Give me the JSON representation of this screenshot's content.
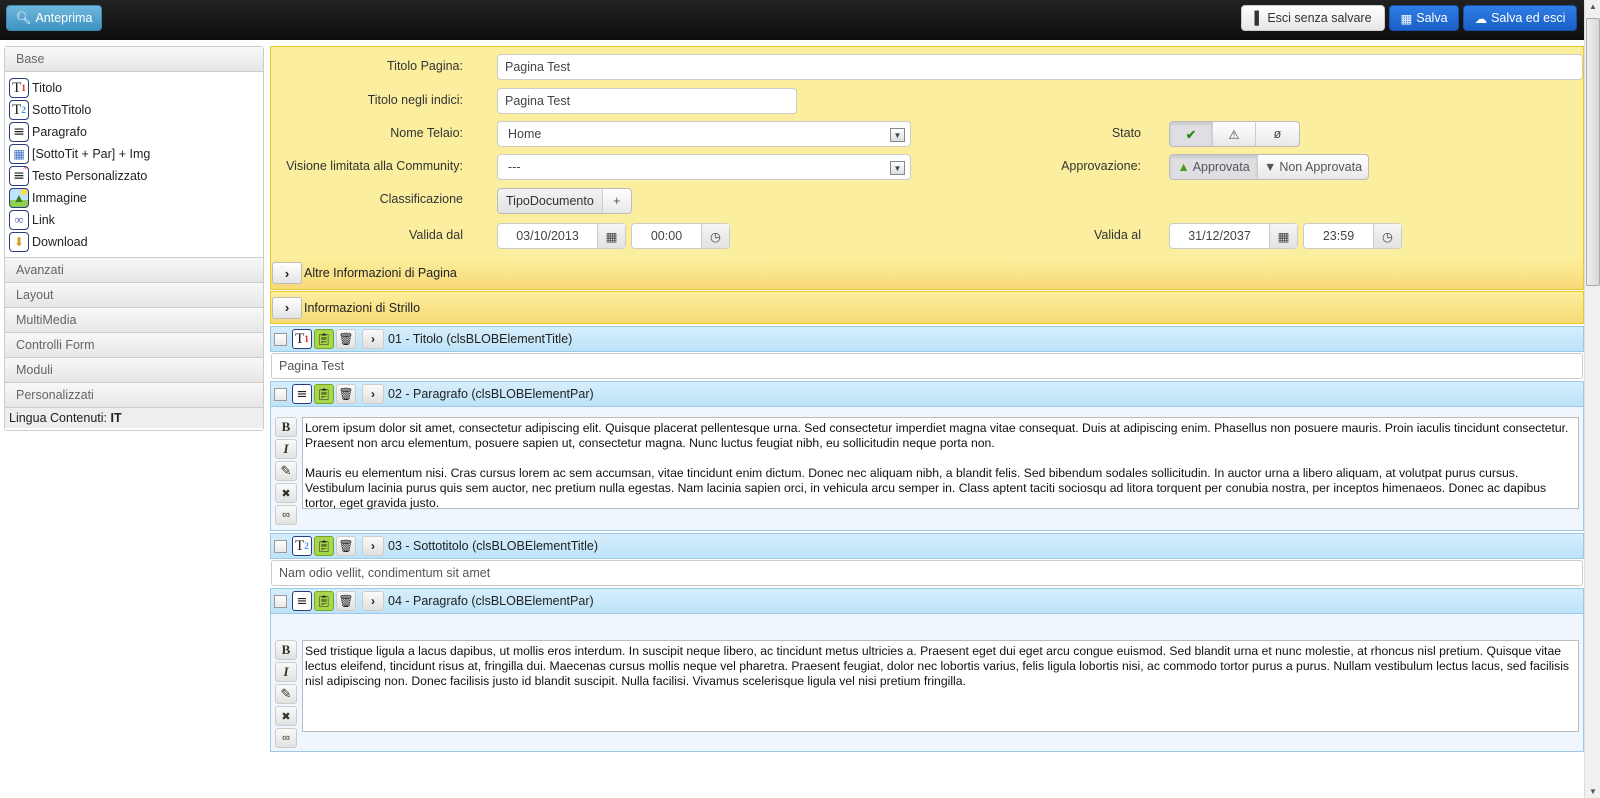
{
  "toolbar": {
    "preview_label": "Anteprima",
    "exit_label": "Esci senza salvare",
    "save_label": "Salva",
    "save_exit_label": "Salva ed esci"
  },
  "sidebar": {
    "sections": [
      {
        "label": "Base",
        "expanded": true
      },
      {
        "label": "Avanzati"
      },
      {
        "label": "Layout"
      },
      {
        "label": "MultiMedia"
      },
      {
        "label": "Controlli Form"
      },
      {
        "label": "Moduli"
      },
      {
        "label": "Personalizzati"
      }
    ],
    "base_items": [
      {
        "label": "Titolo",
        "icon": "title-t1-icon"
      },
      {
        "label": "SottoTitolo",
        "icon": "subtitle-t2-icon"
      },
      {
        "label": "Paragrafo",
        "icon": "paragraph-icon"
      },
      {
        "label": "[SottoTit + Par] + Img",
        "icon": "subtitle-paragraph-image-icon"
      },
      {
        "label": "Testo Personalizzato",
        "icon": "custom-text-icon"
      },
      {
        "label": "Immagine",
        "icon": "image-icon"
      },
      {
        "label": "Link",
        "icon": "link-icon"
      },
      {
        "label": "Download",
        "icon": "download-icon"
      }
    ],
    "language_label": "Lingua Contenuti:",
    "language_value": "IT"
  },
  "form": {
    "page_title_label": "Titolo Pagina:",
    "page_title_value": "Pagina Test",
    "index_title_label": "Titolo negli indici:",
    "index_title_value": "Pagina Test",
    "frame_label": "Nome Telaio:",
    "frame_value": "Home",
    "community_label": "Visione limitata alla Community:",
    "community_value": "---",
    "classification_label": "Classificazione",
    "classification_tag": "TipoDocumento",
    "classification_add": "+",
    "valid_from_label": "Valida dal",
    "valid_from_date": "03/10/2013",
    "valid_from_time": "00:00",
    "state_label": "Stato",
    "state_options": [
      "published",
      "warning",
      "hidden"
    ],
    "state_selected": "published",
    "approval_label": "Approvazione:",
    "approval_yes": "Approvata",
    "approval_no": "Non Approvata",
    "approval_selected": "Approvata",
    "valid_to_label": "Valida al",
    "valid_to_date": "31/12/2037",
    "valid_to_time": "23:59"
  },
  "panels": {
    "other_info": "Altre Informazioni di Pagina",
    "strillo_info": "Informazioni di Strillo"
  },
  "elements": [
    {
      "header": "01 - Titolo (clsBLOBElementTitle)",
      "type": "title",
      "value": "Pagina Test"
    },
    {
      "header": "02 - Paragrafo (clsBLOBElementPar)",
      "type": "paragraph",
      "value": "Lorem ipsum dolor sit amet, consectetur adipiscing elit. Quisque placerat pellentesque urna. Sed consectetur imperdiet magna vitae consequat. Duis at adipiscing enim. Phasellus non posuere mauris. Proin iaculis tincidunt consectetur. Praesent non arcu elementum, posuere sapien ut, consectetur magna. Nunc luctus feugiat nibh, eu sollicitudin neque porta non.\n\nMauris eu elementum nisi. Cras cursus lorem ac sem accumsan, vitae tincidunt enim dictum. Donec nec aliquam nibh, a blandit felis. Sed bibendum sodales sollicitudin. In auctor urna a libero aliquam, at volutpat purus cursus. Vestibulum lacinia purus quis sem auctor, nec pretium nulla egestas. Nam lacinia sapien orci, in vehicula arcu semper in. Class aptent taciti sociosqu ad litora torquent per conubia nostra, per inceptos himenaeos. Donec ac dapibus tortor, eget gravida justo."
    },
    {
      "header": "03 - Sottotitolo (clsBLOBElementTitle)",
      "type": "subtitle",
      "value": "Nam odio vellit, condimentum sit amet"
    },
    {
      "header": "04 - Paragrafo (clsBLOBElementPar)",
      "type": "paragraph",
      "value": "Sed tristique ligula a lacus dapibus, ut mollis eros interdum. In suscipit neque libero, ac tincidunt metus ultricies a. Praesent eget dui eget arcu congue euismod. Sed blandit urna et nunc molestie, at rhoncus nisl pretium. Quisque vitae lectus eleifend, tincidunt risus at, fringilla dui. Maecenas cursus mollis neque vel pharetra. Praesent feugiat, dolor nec lobortis varius, felis ligula lobortis nisi, ac commodo tortor purus a purus. Nullam vestibulum lectus lacus, sed facilisis nisl adipiscing non. Donec facilisis justo id blandit suscipit. Nulla facilisi. Vivamus scelerisque ligula vel nisi pretium fringilla."
    }
  ],
  "rte_buttons": [
    "B",
    "I",
    "✎",
    "×",
    "∞"
  ]
}
